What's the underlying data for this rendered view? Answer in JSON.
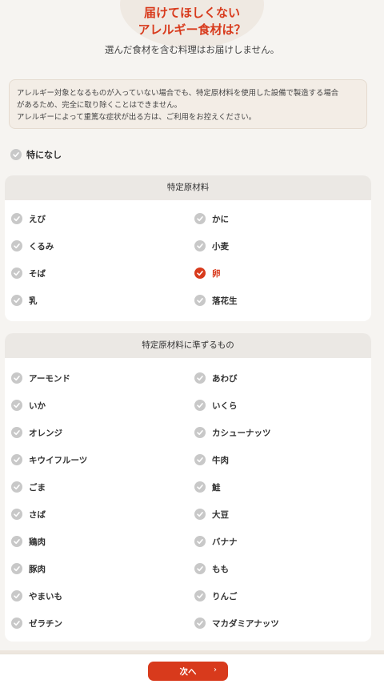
{
  "header": {
    "title_line1": "届けてほしくない",
    "title_line2": "アレルギー食材は？",
    "subtitle": "選んだ食材を含む料理はお届けしません。"
  },
  "notice": {
    "line1": "アレルギー対象となるものが入っていない場合でも、特定原材料を使用した設備で製造する場合",
    "line2": "があるため、完全に取り除くことはできません。",
    "line3": "アレルギーによって重篤な症状が出る方は、ご利用をお控えください。"
  },
  "none_option": {
    "label": "特になし",
    "checked": false
  },
  "section1": {
    "title": "特定原材料",
    "items": [
      {
        "label": "えび",
        "checked": false
      },
      {
        "label": "かに",
        "checked": false
      },
      {
        "label": "くるみ",
        "checked": false
      },
      {
        "label": "小麦",
        "checked": false
      },
      {
        "label": "そば",
        "checked": false
      },
      {
        "label": "卵",
        "checked": true
      },
      {
        "label": "乳",
        "checked": false
      },
      {
        "label": "落花生",
        "checked": false
      }
    ]
  },
  "section2": {
    "title": "特定原材料に準ずるもの",
    "items": [
      {
        "label": "アーモンド",
        "checked": false
      },
      {
        "label": "あわび",
        "checked": false
      },
      {
        "label": "いか",
        "checked": false
      },
      {
        "label": "いくら",
        "checked": false
      },
      {
        "label": "オレンジ",
        "checked": false
      },
      {
        "label": "カシューナッツ",
        "checked": false
      },
      {
        "label": "キウイフルーツ",
        "checked": false
      },
      {
        "label": "牛肉",
        "checked": false
      },
      {
        "label": "ごま",
        "checked": false
      },
      {
        "label": "鮭",
        "checked": false
      },
      {
        "label": "さば",
        "checked": false
      },
      {
        "label": "大豆",
        "checked": false
      },
      {
        "label": "鶏肉",
        "checked": false
      },
      {
        "label": "バナナ",
        "checked": false
      },
      {
        "label": "豚肉",
        "checked": false
      },
      {
        "label": "もも",
        "checked": false
      },
      {
        "label": "やまいも",
        "checked": false
      },
      {
        "label": "りんご",
        "checked": false
      },
      {
        "label": "ゼラチン",
        "checked": false
      },
      {
        "label": "マカダミアナッツ",
        "checked": false
      }
    ]
  },
  "footer": {
    "next_label": "次へ",
    "next_arrow": "›"
  },
  "colors": {
    "accent": "#d83a1c",
    "unchecked": "#c8c8c8",
    "background": "#f6f4f1"
  }
}
